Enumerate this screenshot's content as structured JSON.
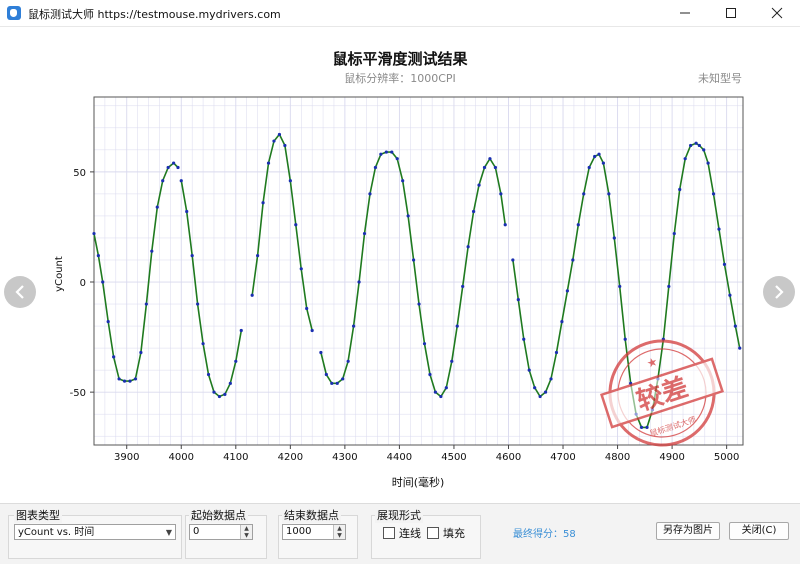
{
  "window": {
    "title": "鼠标测试大师 https://testmouse.mydrivers.com",
    "controls": [
      "minimize",
      "maximize",
      "close"
    ]
  },
  "header": {
    "title": "鼠标平滑度测试结果",
    "subtitle": "鼠标分辨率：1000CPI",
    "model": "未知型号"
  },
  "stamp": {
    "text": "较差",
    "ring_text": "鼠标测试大师"
  },
  "chart_data": {
    "type": "scatter",
    "xlabel": "时间(毫秒)",
    "ylabel": "yCount",
    "xlim": [
      3840,
      5030
    ],
    "ylim": [
      -74,
      84
    ],
    "x_ticks": [
      3900,
      4000,
      4100,
      4200,
      4300,
      4400,
      4500,
      4600,
      4700,
      4800,
      4900,
      5000
    ],
    "y_ticks": [
      50,
      0,
      -50
    ],
    "grid": true,
    "series": [
      {
        "color": "#1f7a1f",
        "points": [
          [
            3840,
            22
          ],
          [
            3848,
            12
          ],
          [
            3856,
            0
          ],
          [
            3866,
            -18
          ],
          [
            3876,
            -34
          ],
          [
            3886,
            -44
          ],
          [
            3896,
            -45
          ],
          [
            3906,
            -45
          ],
          [
            3916,
            -44
          ],
          [
            3926,
            -32
          ],
          [
            3936,
            -10
          ],
          [
            3946,
            14
          ],
          [
            3956,
            34
          ],
          [
            3966,
            46
          ],
          [
            3976,
            52
          ],
          [
            3986,
            54
          ],
          [
            3994,
            52
          ],
          [
            4000,
            46
          ],
          [
            4010,
            32
          ],
          [
            4020,
            12
          ],
          [
            4030,
            -10
          ],
          [
            4040,
            -28
          ],
          [
            4050,
            -42
          ],
          [
            4060,
            -50
          ],
          [
            4070,
            -52
          ],
          [
            4080,
            -51
          ],
          [
            4090,
            -46
          ],
          [
            4100,
            -36
          ],
          [
            4110,
            -22
          ],
          [
            4130,
            -6
          ],
          [
            4140,
            12
          ],
          [
            4150,
            36
          ],
          [
            4160,
            54
          ],
          [
            4170,
            64
          ],
          [
            4180,
            67
          ],
          [
            4190,
            62
          ],
          [
            4200,
            46
          ],
          [
            4210,
            26
          ],
          [
            4220,
            6
          ],
          [
            4230,
            -12
          ],
          [
            4240,
            -22
          ],
          [
            4256,
            -32
          ],
          [
            4266,
            -42
          ],
          [
            4276,
            -46
          ],
          [
            4286,
            -46
          ],
          [
            4296,
            -44
          ],
          [
            4306,
            -36
          ],
          [
            4316,
            -20
          ],
          [
            4326,
            0
          ],
          [
            4336,
            22
          ],
          [
            4346,
            40
          ],
          [
            4356,
            52
          ],
          [
            4366,
            58
          ],
          [
            4376,
            59
          ],
          [
            4386,
            59
          ],
          [
            4396,
            56
          ],
          [
            4406,
            46
          ],
          [
            4416,
            30
          ],
          [
            4426,
            10
          ],
          [
            4436,
            -10
          ],
          [
            4446,
            -28
          ],
          [
            4456,
            -42
          ],
          [
            4466,
            -50
          ],
          [
            4476,
            -52
          ],
          [
            4486,
            -48
          ],
          [
            4496,
            -36
          ],
          [
            4506,
            -20
          ],
          [
            4516,
            -2
          ],
          [
            4526,
            16
          ],
          [
            4536,
            32
          ],
          [
            4546,
            44
          ],
          [
            4556,
            52
          ],
          [
            4566,
            56
          ],
          [
            4576,
            52
          ],
          [
            4586,
            40
          ],
          [
            4594,
            26
          ],
          [
            4608,
            10
          ],
          [
            4618,
            -8
          ],
          [
            4628,
            -26
          ],
          [
            4638,
            -40
          ],
          [
            4648,
            -48
          ],
          [
            4658,
            -52
          ],
          [
            4668,
            -50
          ],
          [
            4678,
            -44
          ],
          [
            4688,
            -32
          ],
          [
            4698,
            -18
          ],
          [
            4708,
            -4
          ],
          [
            4718,
            10
          ],
          [
            4728,
            26
          ],
          [
            4738,
            40
          ],
          [
            4748,
            52
          ],
          [
            4758,
            57
          ],
          [
            4766,
            58
          ],
          [
            4774,
            54
          ],
          [
            4784,
            40
          ],
          [
            4794,
            20
          ],
          [
            4804,
            -2
          ],
          [
            4814,
            -26
          ],
          [
            4824,
            -46
          ],
          [
            4834,
            -60
          ],
          [
            4844,
            -66
          ],
          [
            4854,
            -66
          ],
          [
            4864,
            -58
          ],
          [
            4874,
            -44
          ],
          [
            4884,
            -26
          ],
          [
            4894,
            -2
          ],
          [
            4904,
            22
          ],
          [
            4914,
            42
          ],
          [
            4924,
            56
          ],
          [
            4934,
            62
          ],
          [
            4944,
            63
          ],
          [
            4950,
            62
          ],
          [
            4958,
            60
          ],
          [
            4966,
            54
          ],
          [
            4976,
            40
          ],
          [
            4986,
            24
          ],
          [
            4996,
            8
          ],
          [
            5006,
            -6
          ],
          [
            5016,
            -20
          ],
          [
            5024,
            -30
          ]
        ],
        "breaks_after_x": [
          3994,
          4110,
          4240,
          4594
        ]
      }
    ]
  },
  "bottom": {
    "chart_type_label": "图表类型",
    "chart_type_value": "yCount vs. 时间",
    "start_label": "起始数据点",
    "start_value": "0",
    "end_label": "结束数据点",
    "end_value": "1000",
    "display_label": "展现形式",
    "line_label": "连线",
    "fill_label": "填充",
    "line_checked": false,
    "fill_checked": false,
    "score_text": "最终得分：58",
    "save_label": "另存为图片",
    "close_label": "关闭(C)"
  },
  "colors": {
    "line": "#1f7a1f",
    "dot": "#1a2fb0",
    "grid": "#d9d9ee",
    "score": "#3a8fd6",
    "stamp": "#d23a3a"
  }
}
